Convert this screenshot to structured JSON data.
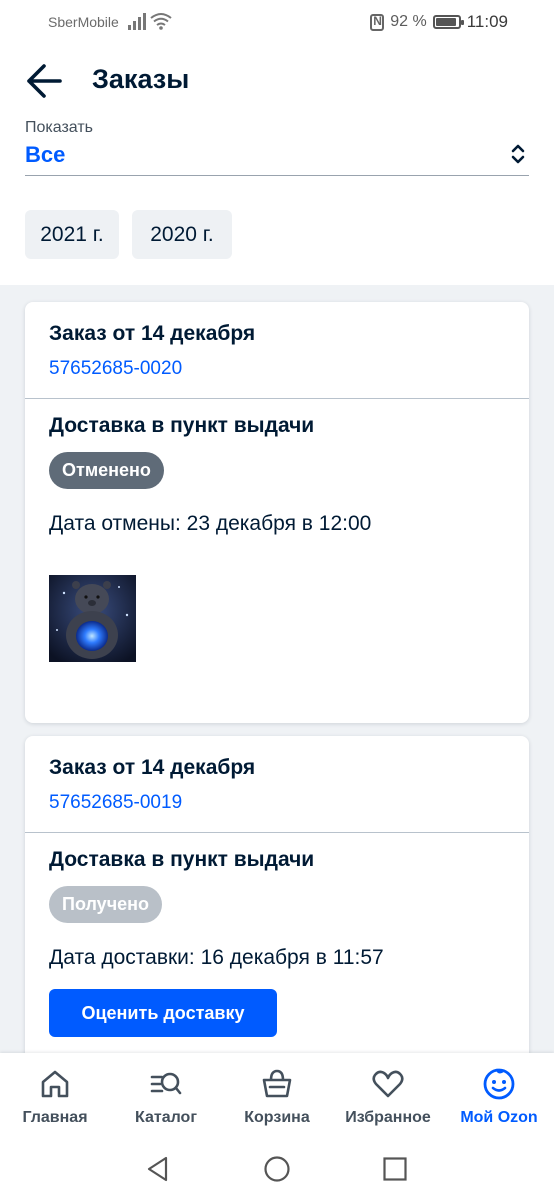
{
  "status_bar": {
    "carrier": "SberMobile",
    "battery_text": "92 %",
    "battery_level": 0.92,
    "time": "11:09"
  },
  "header": {
    "title": "Заказы",
    "back_icon": "arrow-left-icon"
  },
  "filter": {
    "label": "Показать",
    "value": "Все"
  },
  "year_filters": [
    "2021 г.",
    "2020 г."
  ],
  "orders": [
    {
      "title": "Заказ от 14 декабря",
      "number": "57652685-0020",
      "delivery_type": "Доставка в пункт выдачи",
      "status": "Отменено",
      "status_date": "Дата отмены: 23 декабря в 12:00",
      "product_image": "glowing-teddy-bear-nightlight"
    },
    {
      "title": "Заказ от 14 декабря",
      "number": "57652685-0019",
      "delivery_type": "Доставка в пункт выдачи",
      "status": "Получено",
      "status_date": "Дата доставки: 16 декабря в 11:57",
      "action_label": "Оценить доставку"
    }
  ],
  "bottom_nav": [
    {
      "label": "Главная",
      "icon": "home-icon",
      "active": false
    },
    {
      "label": "Каталог",
      "icon": "catalog-search-icon",
      "active": false
    },
    {
      "label": "Корзина",
      "icon": "basket-icon",
      "active": false
    },
    {
      "label": "Избранное",
      "icon": "heart-icon",
      "active": false
    },
    {
      "label": "Мой Ozon",
      "icon": "smiley-icon",
      "active": true
    }
  ],
  "colors": {
    "accent": "#005bff",
    "text": "#001a34",
    "list_background": "#eff2f5",
    "badge_cancelled": "#5f6b78",
    "badge_received": "#b9c0c8"
  }
}
